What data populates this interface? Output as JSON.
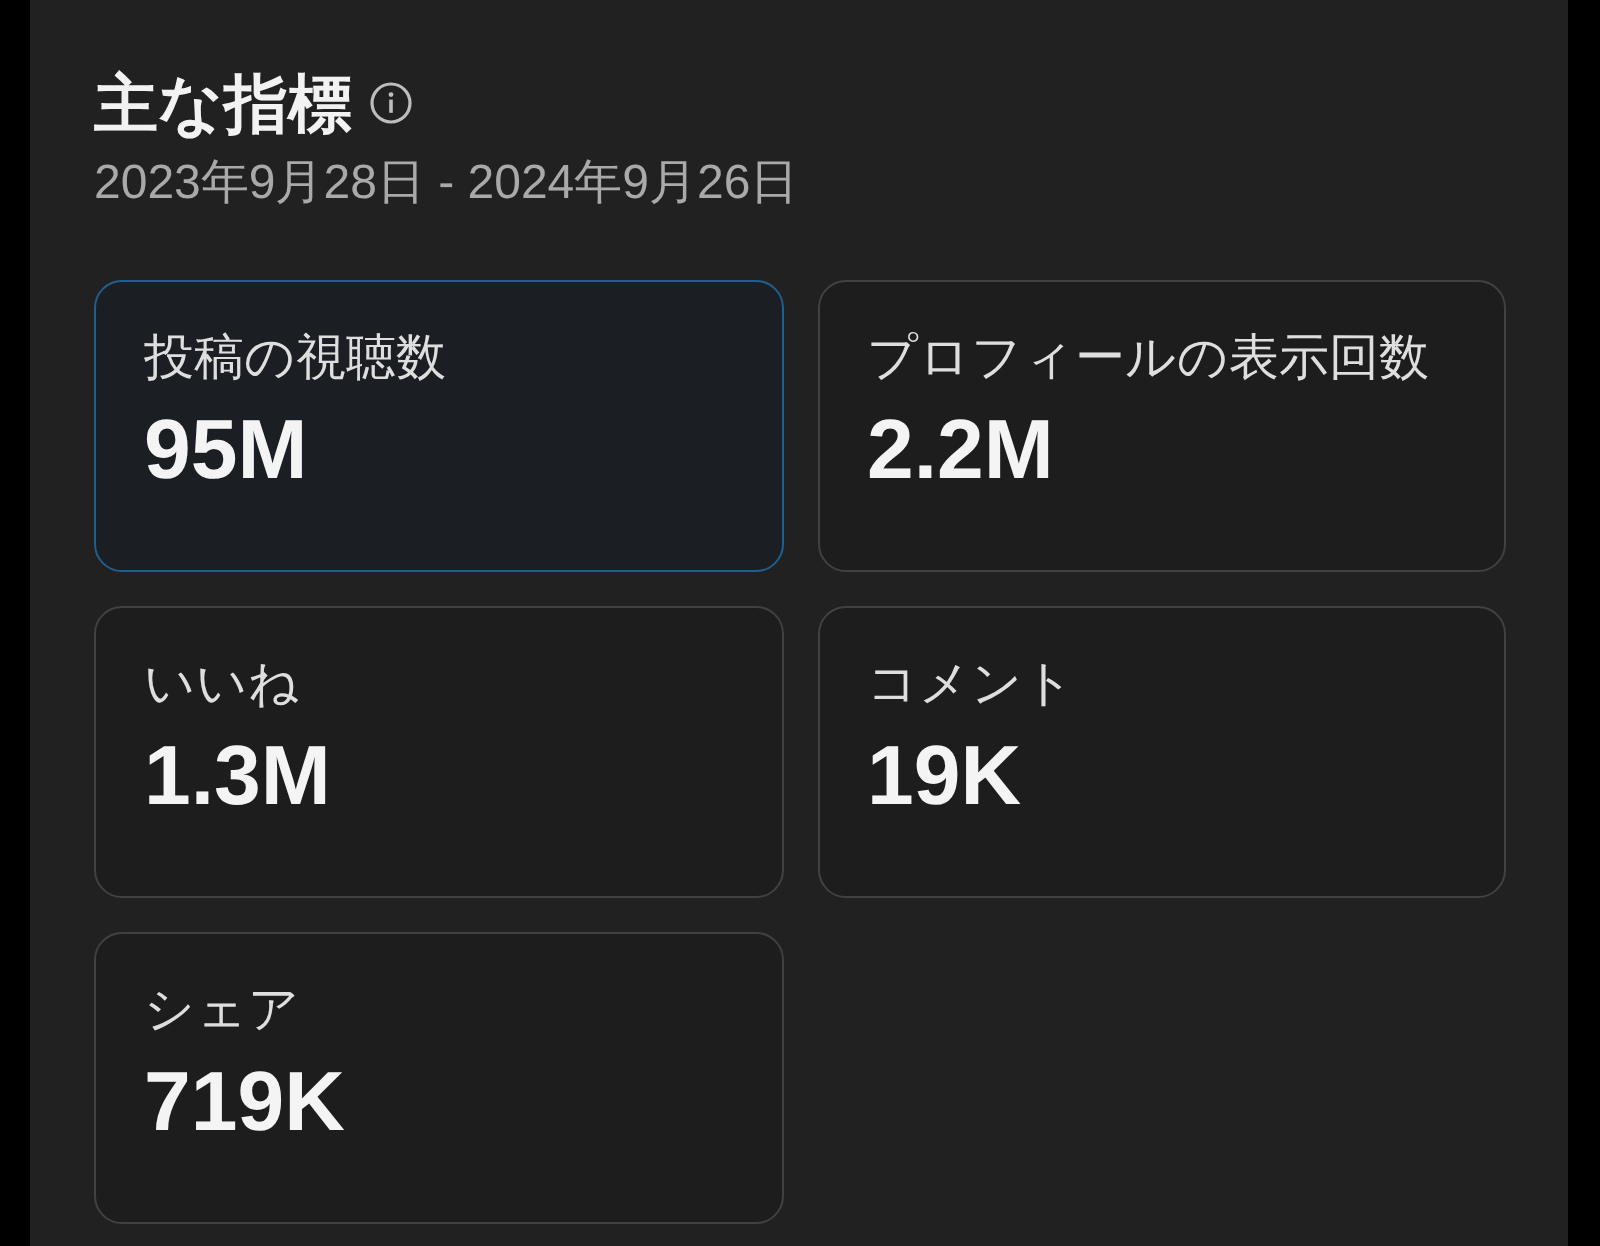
{
  "header": {
    "title": "主な指標",
    "date_range": "2023年9月28日 - 2024年9月26日"
  },
  "metrics": [
    {
      "label": "投稿の視聴数",
      "value": "95M",
      "selected": true
    },
    {
      "label": "プロフィールの表示回数",
      "value": "2.2M",
      "selected": false
    },
    {
      "label": "いいね",
      "value": "1.3M",
      "selected": false
    },
    {
      "label": "コメント",
      "value": "19K",
      "selected": false
    },
    {
      "label": "シェア",
      "value": "719K",
      "selected": false
    }
  ]
}
